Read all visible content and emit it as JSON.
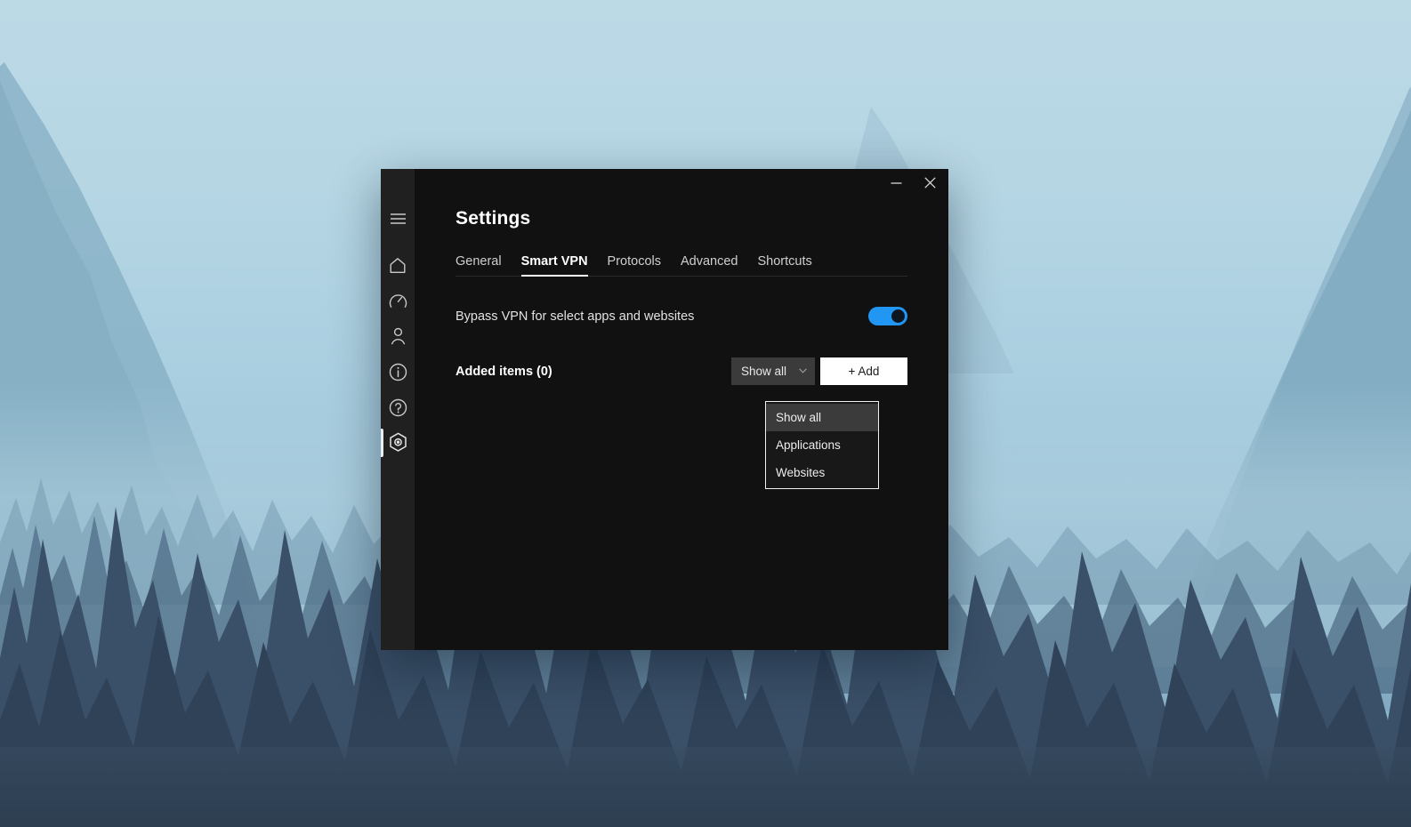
{
  "desktop": {
    "wallpaper_name": "mountain-forest-wallpaper",
    "sky_color": "#b6d6e4",
    "mountain_color": "#8cb5c8",
    "forest_color": "#3c5268"
  },
  "window": {
    "titlebar": {
      "minimize_label": "Minimize",
      "minimize_icon": "minimize-icon",
      "close_label": "Close",
      "close_icon": "close-icon"
    },
    "page_title": "Settings"
  },
  "sidebar": {
    "items": [
      {
        "name": "menu",
        "icon": "hamburger-menu-icon",
        "label": "Menu",
        "active": false
      },
      {
        "name": "home",
        "icon": "home-icon",
        "label": "Home",
        "active": false
      },
      {
        "name": "speedtest",
        "icon": "speedometer-icon",
        "label": "Speed test",
        "active": false
      },
      {
        "name": "account",
        "icon": "person-icon",
        "label": "Account",
        "active": false
      },
      {
        "name": "info",
        "icon": "info-circle-icon",
        "label": "Info",
        "active": false
      },
      {
        "name": "help",
        "icon": "question-circle-icon",
        "label": "Help",
        "active": false
      },
      {
        "name": "settings",
        "icon": "gear-hex-icon",
        "label": "Settings",
        "active": true
      }
    ]
  },
  "tabs": [
    {
      "label": "General",
      "active": false
    },
    {
      "label": "Smart VPN",
      "active": true
    },
    {
      "label": "Protocols",
      "active": false
    },
    {
      "label": "Advanced",
      "active": false
    },
    {
      "label": "Shortcuts",
      "active": false
    }
  ],
  "smart_vpn": {
    "bypass": {
      "label": "Bypass VPN for select apps and websites",
      "toggle_state": "on",
      "toggle_color": "#2196f3"
    },
    "added_items": {
      "label": "Added items (0)",
      "count": 0
    },
    "filter_select": {
      "value": "Show all",
      "caret_icon": "chevron-down-icon",
      "expanded": true,
      "options": [
        {
          "label": "Show all",
          "selected": true
        },
        {
          "label": "Applications",
          "selected": false
        },
        {
          "label": "Websites",
          "selected": false
        }
      ]
    },
    "add_button": {
      "label": "+ Add"
    }
  }
}
